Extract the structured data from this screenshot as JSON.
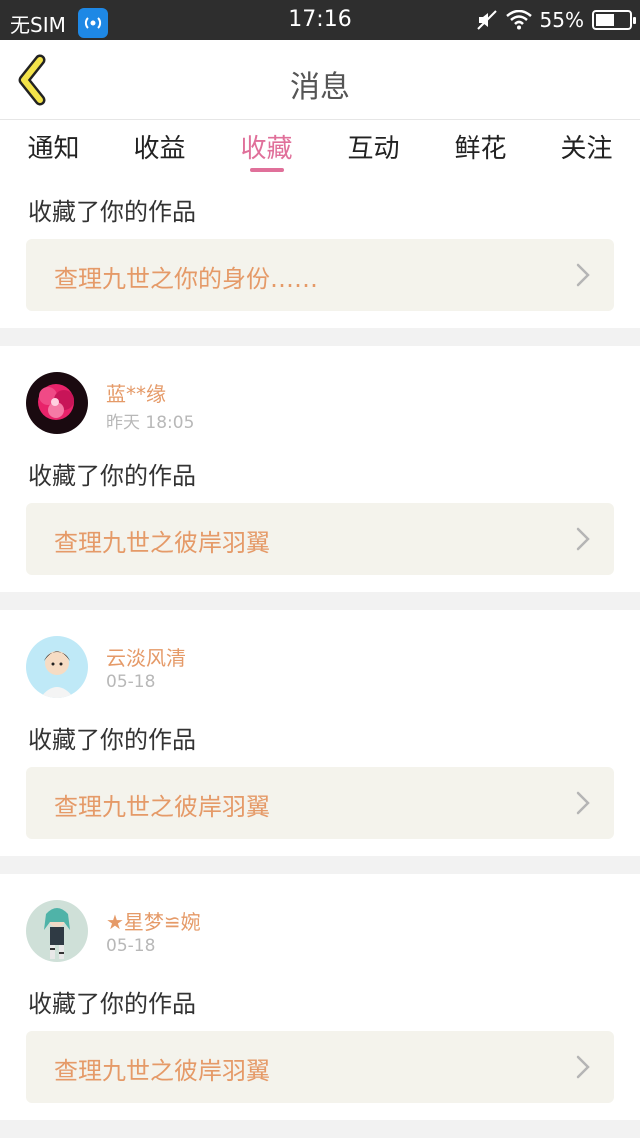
{
  "status_bar": {
    "carrier": "无SIM",
    "time": "17:16",
    "battery": "55%"
  },
  "header": {
    "title": "消息",
    "back_icon": "chevron-left-icon"
  },
  "tabs": [
    {
      "label": "通知",
      "active": false
    },
    {
      "label": "收益",
      "active": false
    },
    {
      "label": "收藏",
      "active": true
    },
    {
      "label": "互动",
      "active": false
    },
    {
      "label": "鲜花",
      "active": false
    },
    {
      "label": "关注",
      "active": false
    }
  ],
  "colors": {
    "accent": "#e0709a",
    "link": "#e59a68",
    "box_bg": "#f4f3ec"
  },
  "items": [
    {
      "action": "收藏了你的作品",
      "work": "查理九世之你的身份……"
    },
    {
      "user": "蓝**缘",
      "time": "昨天 18:05",
      "action": "收藏了你的作品",
      "work": "查理九世之彼岸羽翼"
    },
    {
      "user": "云淡风清",
      "time": "05-18",
      "action": "收藏了你的作品",
      "work": "查理九世之彼岸羽翼"
    },
    {
      "user": "★星梦≌婉",
      "time": "05-18",
      "action": "收藏了你的作品",
      "work": "查理九世之彼岸羽翼"
    }
  ]
}
